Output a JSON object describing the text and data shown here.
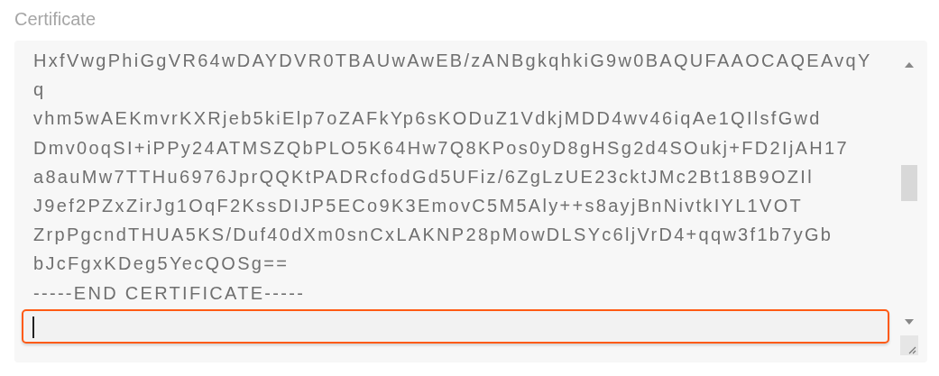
{
  "field": {
    "label": "Certificate",
    "lines": [
      "HxfVwgPhiGgVR64wDAYDVR0TBAUwAwEB/zANBgkqhkiG9w0BAQUFAAOCAQEAvqY",
      "q",
      "vhm5wAEKmvrKXRjeb5kiElp7oZAFkYp6sKODuZ1VdkjMDD4wv46iqAe1QIlsfGwd",
      "Dmv0oqSI+iPPy24ATMSZQbPLO5K64Hw7Q8KPos0yD8gHSg2d4SOukj+FD2IjAH17",
      "a8auMw7TTHu6976JprQQKtPADRcfodGd5UFiz/6ZgLzUE23cktJMc2Bt18B9OZIl",
      "J9ef2PZxZirJg1OqF2KssDIJP5ECo9K3EmovC5M5Aly++s8ayjBnNivtkIYL1VOT",
      "ZrpPgcndTHUA5KS/Duf40dXm0snCxLAKNP28pMowDLSYc6ljVrD4+qqw3f1b7yGb",
      "bJcFgxKDeg5YecQOSg==",
      "-----END CERTIFICATE-----"
    ],
    "new_line": {
      "focused": true
    }
  }
}
